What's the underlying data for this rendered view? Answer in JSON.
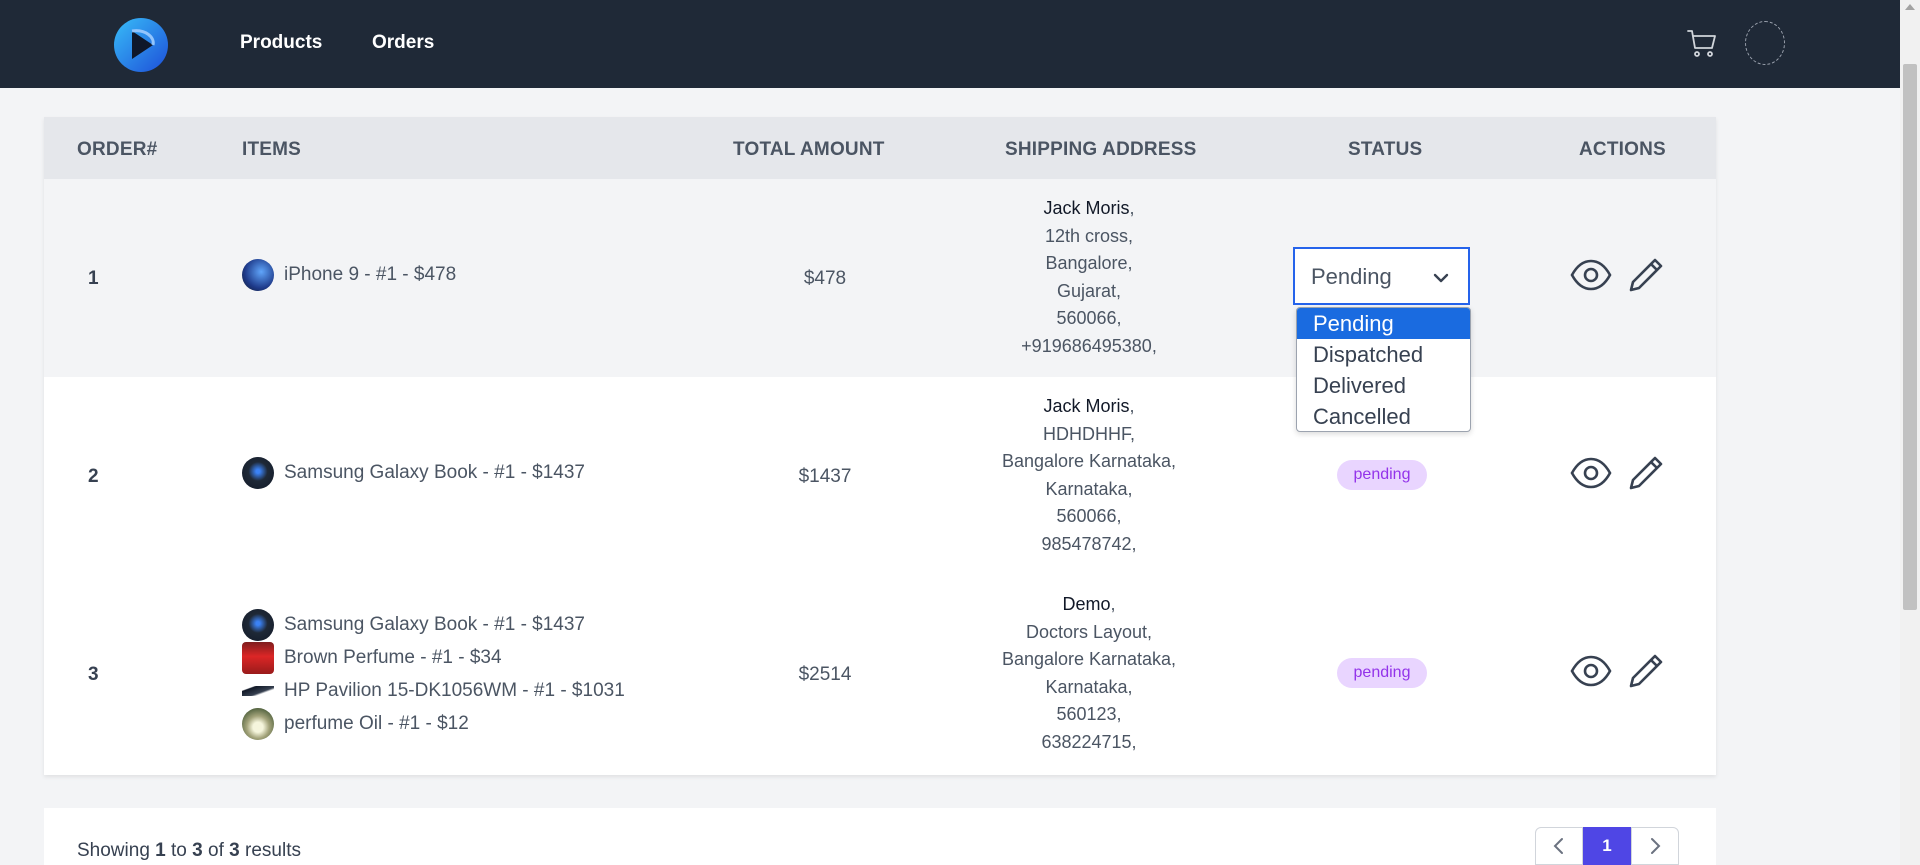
{
  "nav": {
    "products_label": "Products",
    "orders_label": "Orders"
  },
  "table": {
    "headers": {
      "order": "ORDER#",
      "items": "ITEMS",
      "total": "TOTAL AMOUNT",
      "shipping": "SHIPPING ADDRESS",
      "status": "STATUS",
      "actions": "ACTIONS"
    },
    "rows": [
      {
        "order": "1",
        "items": [
          {
            "text": "iPhone 9 - #1 - $478",
            "thumb_color": "#1e3a8a"
          }
        ],
        "total": "$478",
        "address": {
          "name": "Jack Moris",
          "lines": [
            "12th cross,",
            "Bangalore,",
            "Gujarat,",
            "560066,",
            "+919686495380,"
          ]
        },
        "status": "Pending"
      },
      {
        "order": "2",
        "items": [
          {
            "text": "Samsung Galaxy Book - #1 - $1437",
            "thumb_color": "#111827"
          }
        ],
        "total": "$1437",
        "address": {
          "name": "Jack Moris",
          "lines": [
            "HDHDHHF,",
            "Bangalore Karnataka,",
            "Karnataka,",
            "560066,",
            "985478742,"
          ]
        },
        "status": "pending"
      },
      {
        "order": "3",
        "items": [
          {
            "text": "Samsung Galaxy Book - #1 - $1437",
            "thumb_color": "#111827"
          },
          {
            "text": "Brown Perfume - #1 - $34",
            "thumb_color": "#b91c1c"
          },
          {
            "text": "HP Pavilion 15-DK1056WM - #1 - $1031",
            "thumb_color": "#1f2937"
          },
          {
            "text": "perfume Oil - #1 - $12",
            "thumb_color": "#6b8e23"
          }
        ],
        "total": "$2514",
        "address": {
          "name": "Demo",
          "lines": [
            "Doctors Layout,",
            "Bangalore Karnataka,",
            "Karnataka,",
            "560123,",
            "638224715,"
          ]
        },
        "status": "pending"
      }
    ]
  },
  "status_select": {
    "value": "Pending",
    "options": [
      "Pending",
      "Dispatched",
      "Delivered",
      "Cancelled"
    ],
    "selected_index": 0
  },
  "pagination": {
    "showing_prefix": "Showing",
    "from": "1",
    "to_word": "to",
    "to": "3",
    "of_word": "of",
    "total": "3",
    "results_word": "results",
    "current_page": "1"
  },
  "colors": {
    "navbar": "#1f2937",
    "accent": "#4f46e5",
    "badge_bg": "#e9d5ff",
    "badge_text": "#9333ea",
    "select_border": "#2563eb"
  }
}
